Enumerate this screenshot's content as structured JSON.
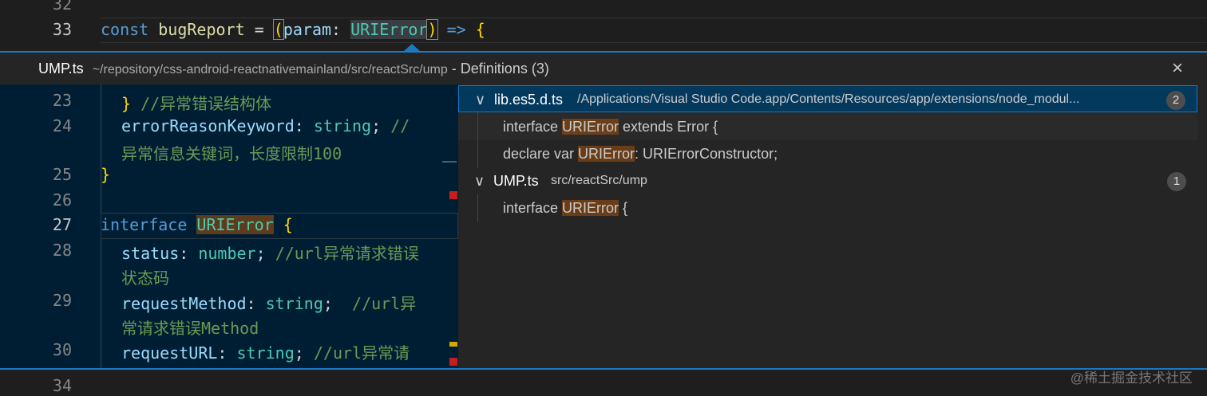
{
  "top_editor": {
    "lines": [
      {
        "num": "32"
      },
      {
        "num": "33",
        "t": [
          "const",
          "bugReport",
          "=",
          "(",
          "param",
          ":",
          "URIError",
          ")",
          "=>",
          "{"
        ]
      }
    ]
  },
  "peek": {
    "file": "UMP.ts",
    "path": "~/repository/css-android-reactnativemainland/src/reactSrc/ump",
    "title": "- Definitions (3)",
    "close": "×",
    "left_lines": [
      {
        "num": "23",
        "code": "} ",
        "comment": "//异常错误结构体"
      },
      {
        "num": "24",
        "prop": "errorReasonKeyword",
        "type": "string",
        "comment": "//",
        "wrap": "异常信息关键词，长度限制100"
      },
      {
        "num": "25",
        "code": "}"
      },
      {
        "num": "26"
      },
      {
        "num": "27",
        "kw": "interface",
        "name": "URIError",
        "brace": "{"
      },
      {
        "num": "28",
        "prop": "status",
        "type": "number",
        "comment": "//url异常请求错误",
        "wrap": "状态码"
      },
      {
        "num": "29",
        "prop": "requestMethod",
        "type": "string",
        "comment": " //url异",
        "wrap": "常请求错误Method"
      },
      {
        "num": "30",
        "prop": "requestURL",
        "type": "string",
        "comment": "//url异常请"
      }
    ],
    "groups": [
      {
        "file": "lib.es5.d.ts",
        "path": "/Applications/Visual Studio Code.app/Contents/Resources/app/extensions/node_modul...",
        "count": "2",
        "items": [
          {
            "pre": "interface ",
            "match": "URIError",
            "post": " extends Error {"
          },
          {
            "pre": "declare var ",
            "match": "URIError",
            "post": ": URIErrorConstructor;"
          }
        ]
      },
      {
        "file": "UMP.ts",
        "path": "src/reactSrc/ump",
        "count": "1",
        "items": [
          {
            "pre": "interface ",
            "match": "URIError",
            "post": " {"
          }
        ]
      }
    ]
  },
  "bottom_editor": {
    "num": "34"
  },
  "watermark": "@稀土掘金技术社区"
}
